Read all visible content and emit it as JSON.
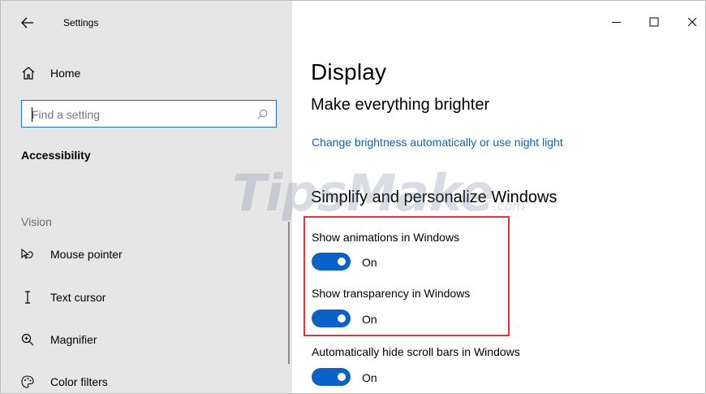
{
  "window": {
    "title": "Settings"
  },
  "sidebar": {
    "home_label": "Home",
    "search": {
      "placeholder": "Find a setting"
    },
    "section_title": "Accessibility",
    "group_title": "Vision",
    "items": [
      {
        "label": "Mouse pointer",
        "icon": "mouse-pointer-icon"
      },
      {
        "label": "Text cursor",
        "icon": "text-cursor-icon"
      },
      {
        "label": "Magnifier",
        "icon": "magnifier-icon"
      },
      {
        "label": "Color filters",
        "icon": "color-filters-icon"
      }
    ]
  },
  "main": {
    "page_title": "Display",
    "subheading_brightness": "Make everything brighter",
    "brightness_link": "Change brightness automatically or use night light",
    "subheading_simplify": "Simplify and personalize Windows",
    "settings": [
      {
        "label": "Show animations in Windows",
        "state": "On",
        "enabled": true
      },
      {
        "label": "Show transparency in Windows",
        "state": "On",
        "enabled": true
      },
      {
        "label": "Automatically hide scroll bars in Windows",
        "state": "On",
        "enabled": true
      }
    ]
  },
  "watermark": {
    "text": "TipsMake",
    "suffix": ".com"
  },
  "colors": {
    "accent": "#0a62c8",
    "link": "#0a64b8",
    "highlight_border": "#e0353a",
    "sidebar_bg": "#e6e6e6"
  }
}
